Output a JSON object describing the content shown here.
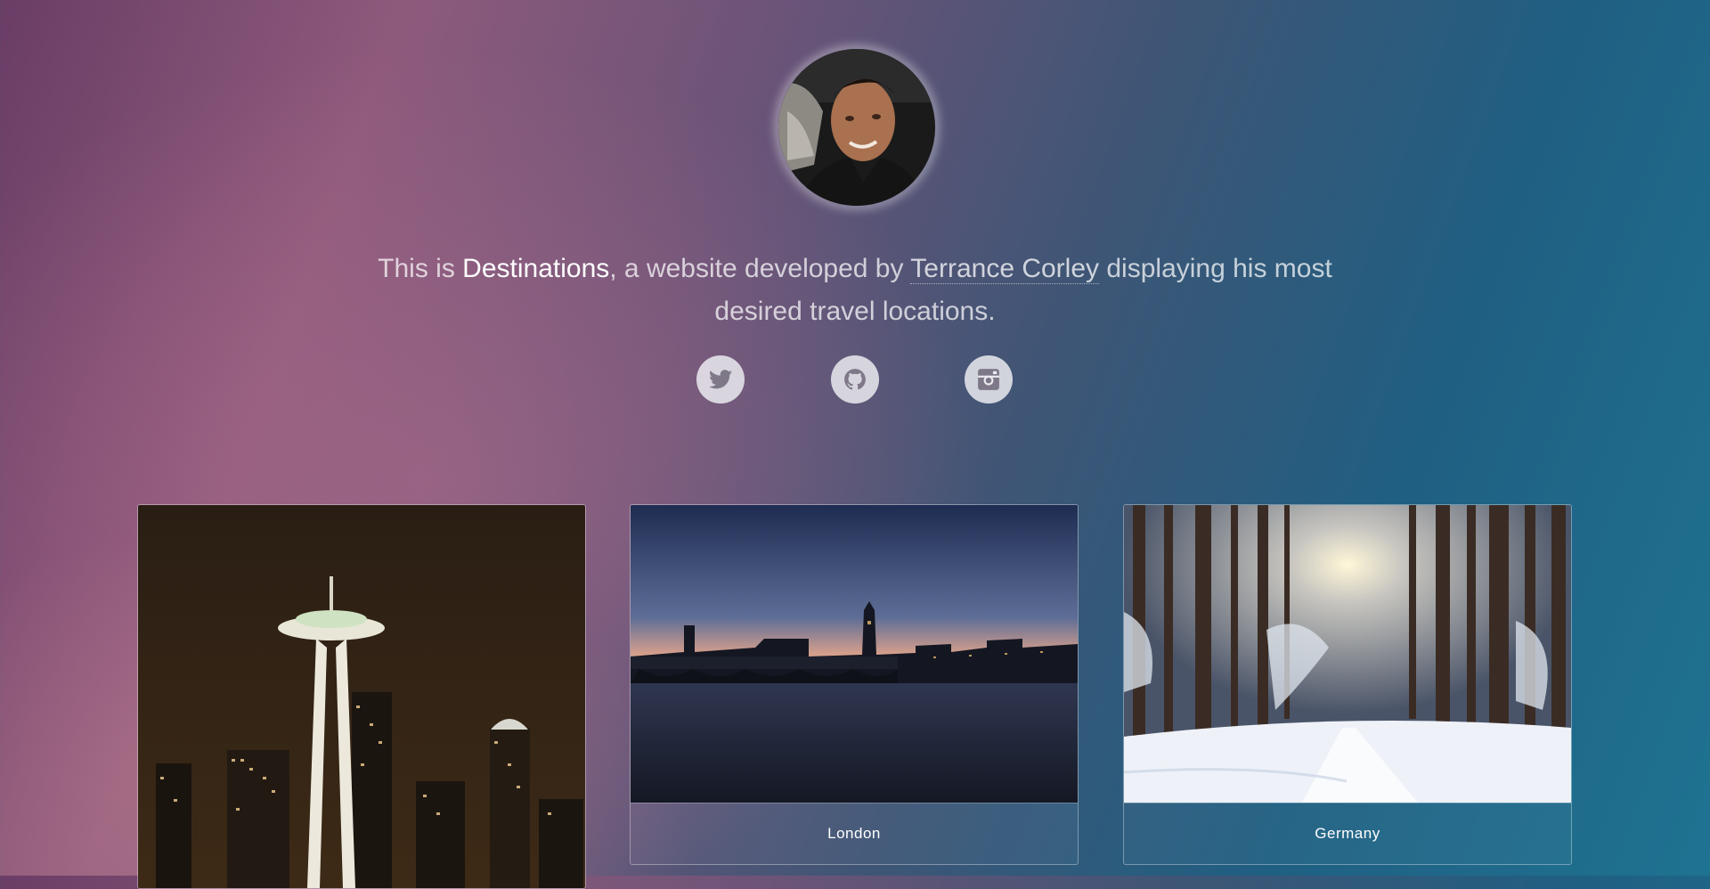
{
  "profile": {
    "avatar_alt": "Terrance Corley"
  },
  "intro": {
    "prefix": "This is ",
    "brand": "Destinations",
    "middle": ", a website developed by ",
    "author": "Terrance Corley",
    "suffix": " displaying his most desired travel locations."
  },
  "social": [
    {
      "name": "twitter",
      "icon": "twitter-icon"
    },
    {
      "name": "github",
      "icon": "github-icon"
    },
    {
      "name": "instagram",
      "icon": "instagram-icon"
    }
  ],
  "destinations": [
    {
      "caption": ""
    },
    {
      "caption": "London"
    },
    {
      "caption": "Germany"
    }
  ]
}
